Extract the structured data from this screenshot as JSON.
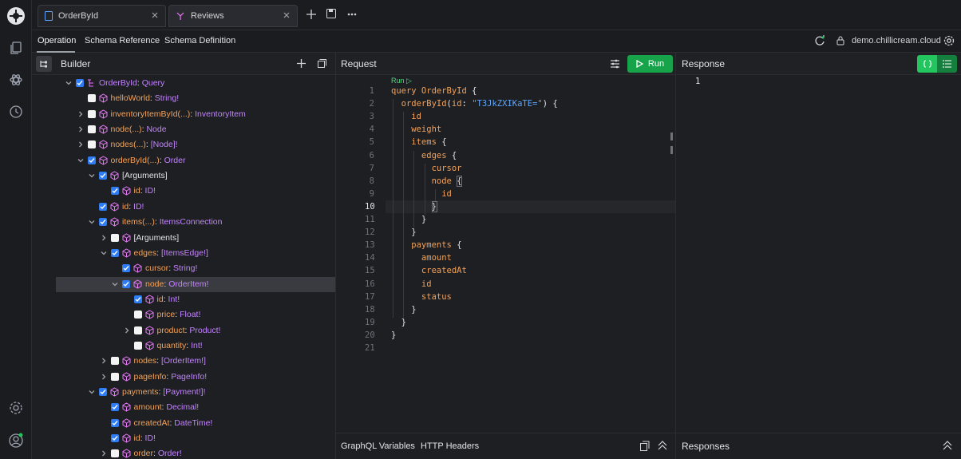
{
  "tabs": [
    {
      "label": "OrderById",
      "active": false
    },
    {
      "label": "Reviews",
      "active": true
    }
  ],
  "subnav": {
    "items": [
      "Operation",
      "Schema Reference",
      "Schema Definition"
    ],
    "domain": "demo.chillicream.cloud"
  },
  "builder": {
    "title": "Builder",
    "tree": [
      {
        "name": "OrderById",
        "type": "Query",
        "checked": true,
        "expanded": true,
        "kind": "root"
      },
      {
        "name": "helloWorld",
        "type": "String!",
        "checked": false
      },
      {
        "name": "inventoryItemById(...)",
        "type": "InventoryItem",
        "checked": false,
        "expandable": true
      },
      {
        "name": "node(...)",
        "type": "Node",
        "checked": false,
        "expandable": true
      },
      {
        "name": "nodes(...)",
        "type": "[Node]!",
        "checked": false,
        "expandable": true
      },
      {
        "name": "orderById(...)",
        "type": "Order",
        "checked": true,
        "expanded": true
      },
      {
        "name": "[Arguments]",
        "type": "",
        "checked": true,
        "expanded": true
      },
      {
        "name": "id",
        "type": "ID!",
        "checked": true
      },
      {
        "name": "id",
        "type": "ID!",
        "checked": true
      },
      {
        "name": "items(...)",
        "type": "ItemsConnection",
        "checked": true,
        "expanded": true
      },
      {
        "name": "[Arguments]",
        "type": "",
        "checked": false,
        "expandable": true
      },
      {
        "name": "edges",
        "type": "[ItemsEdge!]",
        "checked": true,
        "expanded": true
      },
      {
        "name": "cursor",
        "type": "String!",
        "checked": true
      },
      {
        "name": "node",
        "type": "OrderItem!",
        "checked": true,
        "expanded": true,
        "selected": true
      },
      {
        "name": "id",
        "type": "Int!",
        "checked": true
      },
      {
        "name": "price",
        "type": "Float!",
        "checked": false
      },
      {
        "name": "product",
        "type": "Product!",
        "checked": false,
        "expandable": true
      },
      {
        "name": "quantity",
        "type": "Int!",
        "checked": false
      },
      {
        "name": "nodes",
        "type": "[OrderItem!]",
        "checked": false,
        "expandable": true
      },
      {
        "name": "pageInfo",
        "type": "PageInfo!",
        "checked": false,
        "expandable": true
      },
      {
        "name": "payments",
        "type": "[Payment!]!",
        "checked": true,
        "expanded": true
      },
      {
        "name": "amount",
        "type": "Decimal!",
        "checked": true
      },
      {
        "name": "createdAt",
        "type": "DateTime!",
        "checked": true
      },
      {
        "name": "id",
        "type": "ID!",
        "checked": true
      },
      {
        "name": "order",
        "type": "Order!",
        "checked": false,
        "expandable": true
      }
    ]
  },
  "request": {
    "title": "Request",
    "run_label": "Run",
    "codelens": "Run ▷",
    "code_lines": [
      "query OrderById {",
      "  orderById(id: \"T3JkZXIKaTE=\") {",
      "    id",
      "    weight",
      "    items {",
      "      edges {",
      "        cursor",
      "        node {",
      "          id",
      "        }",
      "      }",
      "    }",
      "    payments {",
      "      amount",
      "      createdAt",
      "      id",
      "      status",
      "    }",
      "  }",
      "}",
      ""
    ],
    "current_line": 10,
    "bottom_tabs": [
      "GraphQL Variables",
      "HTTP Headers"
    ]
  },
  "response": {
    "title": "Response",
    "line_numbers": [
      "1"
    ],
    "bottom_label": "Responses"
  },
  "colors": {
    "accent": "#16a34a",
    "checkbox": "#2e7cf6",
    "field": "#f4a259",
    "type": "#c084fc"
  }
}
